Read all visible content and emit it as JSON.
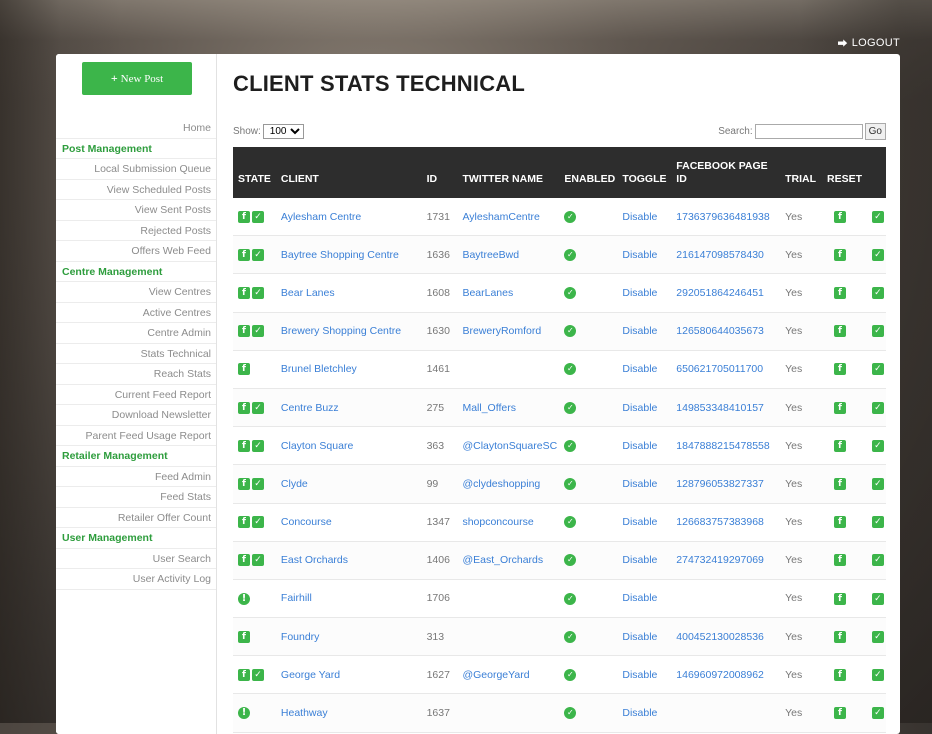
{
  "header": {
    "logout_label": "LOGOUT"
  },
  "sidebar": {
    "new_post_label": "New Post",
    "items": [
      {
        "type": "link",
        "label": "Home"
      },
      {
        "type": "section",
        "label": "Post Management"
      },
      {
        "type": "link",
        "label": "Local Submission Queue"
      },
      {
        "type": "link",
        "label": "View Scheduled Posts"
      },
      {
        "type": "link",
        "label": "View Sent Posts"
      },
      {
        "type": "link",
        "label": "Rejected Posts"
      },
      {
        "type": "link",
        "label": "Offers Web Feed"
      },
      {
        "type": "section",
        "label": "Centre Management"
      },
      {
        "type": "link",
        "label": "View Centres"
      },
      {
        "type": "link",
        "label": "Active Centres"
      },
      {
        "type": "link",
        "label": "Centre Admin"
      },
      {
        "type": "link",
        "label": "Stats Technical"
      },
      {
        "type": "link",
        "label": "Reach Stats"
      },
      {
        "type": "link",
        "label": "Current Feed Report"
      },
      {
        "type": "link",
        "label": "Download Newsletter"
      },
      {
        "type": "link",
        "label": "Parent Feed Usage Report"
      },
      {
        "type": "section",
        "label": "Retailer Management"
      },
      {
        "type": "link",
        "label": "Feed Admin"
      },
      {
        "type": "link",
        "label": "Feed Stats"
      },
      {
        "type": "link",
        "label": "Retailer Offer Count"
      },
      {
        "type": "section",
        "label": "User Management"
      },
      {
        "type": "link",
        "label": "User Search"
      },
      {
        "type": "link",
        "label": "User Activity Log"
      }
    ]
  },
  "main": {
    "title": "CLIENT STATS TECHNICAL",
    "show_label": "Show:",
    "show_value": "100",
    "search_label": "Search:",
    "search_value": "",
    "go_label": "Go",
    "columns": [
      "STATE",
      "CLIENT",
      "ID",
      "TWITTER NAME",
      "ENABLED",
      "TOGGLE",
      "FACEBOOK PAGE ID",
      "TRIAL",
      "RESET",
      ""
    ],
    "rows": [
      {
        "state": "fb-tw",
        "client": "Aylesham Centre",
        "id": "1731",
        "twitter": "AyleshamCentre",
        "toggle": "Disable",
        "fb_id": "1736379636481938",
        "trial": "Yes"
      },
      {
        "state": "fb-tw",
        "client": "Baytree Shopping Centre",
        "id": "1636",
        "twitter": "BaytreeBwd",
        "toggle": "Disable",
        "fb_id": "216147098578430",
        "trial": "Yes"
      },
      {
        "state": "fb-tw",
        "client": "Bear Lanes",
        "id": "1608",
        "twitter": "BearLanes",
        "toggle": "Disable",
        "fb_id": "292051864246451",
        "trial": "Yes"
      },
      {
        "state": "fb-tw",
        "client": "Brewery Shopping Centre",
        "id": "1630",
        "twitter": "BreweryRomford",
        "toggle": "Disable",
        "fb_id": "126580644035673",
        "trial": "Yes"
      },
      {
        "state": "fb",
        "client": "Brunel Bletchley",
        "id": "1461",
        "twitter": "",
        "toggle": "Disable",
        "fb_id": "650621705011700",
        "trial": "Yes"
      },
      {
        "state": "fb-tw",
        "client": "Centre Buzz",
        "id": "275",
        "twitter": "Mall_Offers",
        "toggle": "Disable",
        "fb_id": "149853348410157",
        "trial": "Yes"
      },
      {
        "state": "fb-tw",
        "client": "Clayton Square",
        "id": "363",
        "twitter": "@ClaytonSquareSC",
        "toggle": "Disable",
        "fb_id": "1847888215478558",
        "trial": "Yes"
      },
      {
        "state": "fb-tw",
        "client": "Clyde",
        "id": "99",
        "twitter": "@clydeshopping",
        "toggle": "Disable",
        "fb_id": "128796053827337",
        "trial": "Yes"
      },
      {
        "state": "fb-tw",
        "client": "Concourse",
        "id": "1347",
        "twitter": "shopconcourse",
        "toggle": "Disable",
        "fb_id": "126683757383968",
        "trial": "Yes"
      },
      {
        "state": "fb-tw",
        "client": "East Orchards",
        "id": "1406",
        "twitter": "@East_Orchards",
        "toggle": "Disable",
        "fb_id": "274732419297069",
        "trial": "Yes"
      },
      {
        "state": "warn",
        "client": "Fairhill",
        "id": "1706",
        "twitter": "",
        "toggle": "Disable",
        "fb_id": "",
        "trial": "Yes"
      },
      {
        "state": "fb",
        "client": "Foundry",
        "id": "313",
        "twitter": "",
        "toggle": "Disable",
        "fb_id": "400452130028536",
        "trial": "Yes"
      },
      {
        "state": "fb-tw",
        "client": "George Yard",
        "id": "1627",
        "twitter": "@GeorgeYard",
        "toggle": "Disable",
        "fb_id": "146960972008962",
        "trial": "Yes"
      },
      {
        "state": "warn",
        "client": "Heathway",
        "id": "1637",
        "twitter": "",
        "toggle": "Disable",
        "fb_id": "",
        "trial": "Yes"
      }
    ]
  },
  "colors": {
    "accent_green": "#3cb54a",
    "link_blue": "#3a7fd6",
    "header_dark": "#2d2d2d"
  }
}
